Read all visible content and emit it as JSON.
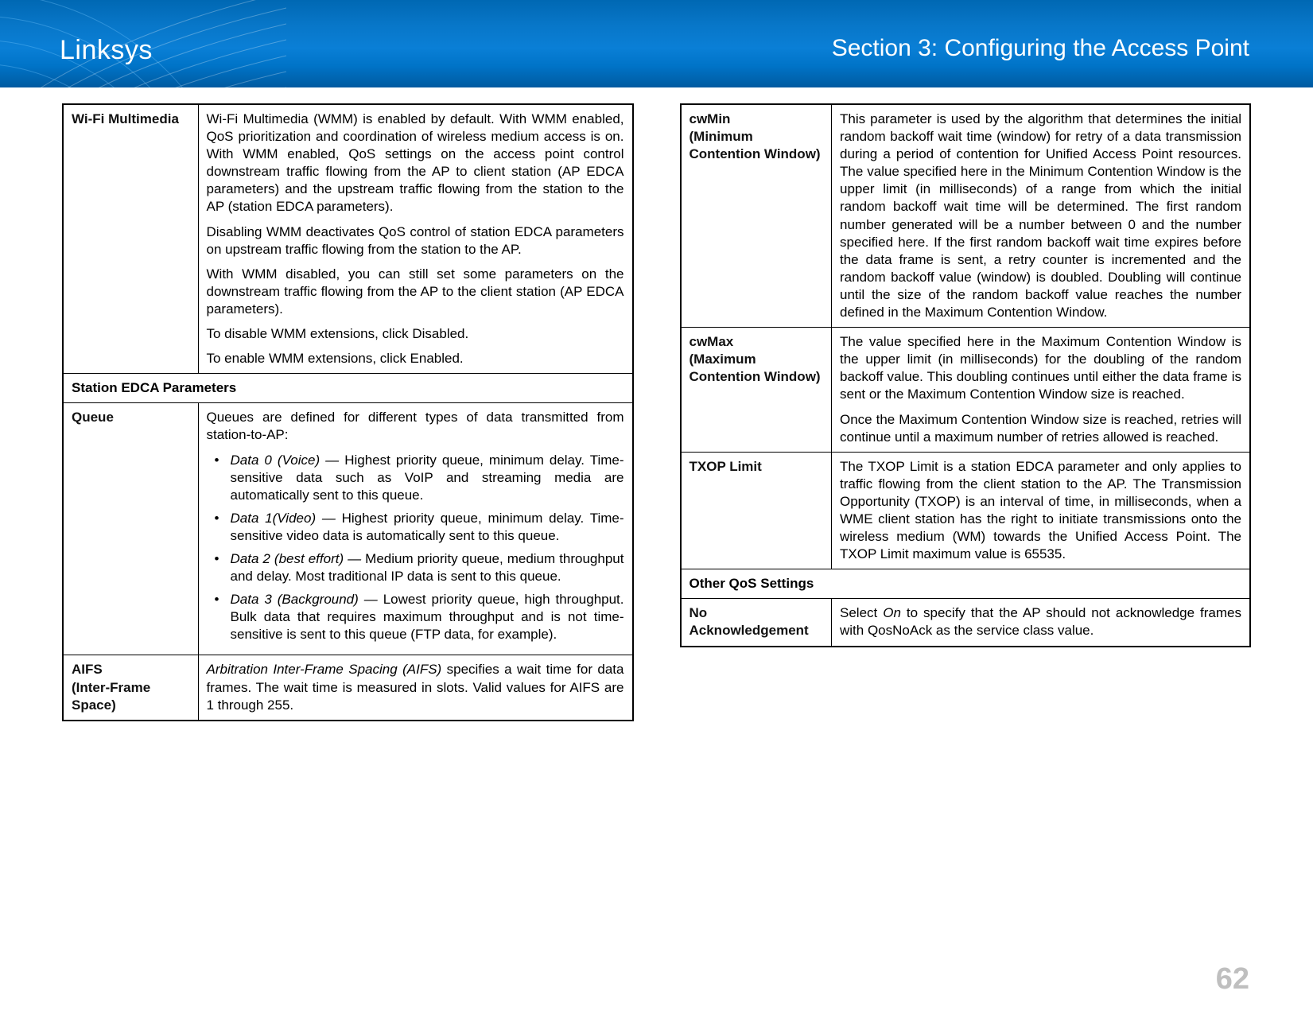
{
  "brand": "Linksys",
  "sectionTitle": "Section 3:  Configuring the Access Point",
  "pageNumber": "62",
  "left": {
    "rows": [
      {
        "label": "Wi-Fi Multimedia",
        "paras": [
          "Wi-Fi Multimedia (WMM) is enabled by default. With WMM enabled, QoS prioritization and coordination of wireless medium access is on. With WMM enabled, QoS settings on the access point control downstream traffic flowing from the AP to client station (AP EDCA parameters) and the upstream traffic flowing from the station to the AP (station EDCA parameters).",
          "Disabling WMM deactivates QoS control of station EDCA parameters on upstream traffic flowing from the station to the AP.",
          "With WMM disabled, you can still set some parameters on the downstream traffic flowing from the AP to the client station (AP EDCA parameters).",
          "To disable WMM extensions, click Disabled.",
          "To enable WMM extensions, click Enabled."
        ]
      }
    ],
    "section1": "Station EDCA Parameters",
    "queue": {
      "label": "Queue",
      "intro": "Queues are defined for different types of data transmitted from station-to-AP:",
      "items": [
        {
          "lead": "Data 0 (Voice) — ",
          "rest": "Highest priority queue, minimum delay. Time-sensitive data such as VoIP and streaming media are automatically sent to this queue."
        },
        {
          "lead": "Data 1(Video) — ",
          "rest": "Highest priority queue, minimum delay. Time-sensitive video data is automatically sent to this queue."
        },
        {
          "lead": "Data 2 (best effort) — ",
          "rest": "Medium priority queue, medium throughput and delay. Most traditional IP data is sent to this queue."
        },
        {
          "lead": "Data 3 (Background) — ",
          "rest": "Lowest priority queue, high throughput. Bulk data that requires maximum throughput and is not time-sensitive is sent to this queue (FTP data, for example)."
        }
      ]
    },
    "aifs": {
      "label1": "AIFS",
      "label2": "(Inter-Frame Space)",
      "lead": "Arbitration Inter-Frame Spacing (AIFS)",
      "rest": " specifies a wait time for data frames. The wait time is measured in slots. Valid values for AIFS are 1 through 255."
    }
  },
  "right": {
    "cwmin": {
      "l1": "cwMin",
      "l2": "(Minimum Contention Window)",
      "p": "This parameter is used by the algorithm that determines the initial random backoff wait time (window) for retry of a data transmission during a period of contention for Unified Access Point resources. The value specified here in the Minimum Contention Window is the upper limit (in milliseconds) of a range from which the initial random backoff wait time will be determined. The first random number generated will be a number between 0 and the number specified here. If the first random backoff wait time expires before the data frame is sent, a retry counter is incremented and the random backoff value (window) is doubled. Doubling will continue until the size of the random backoff value reaches the number defined in the Maximum Contention Window."
    },
    "cwmax": {
      "l1": "cwMax",
      "l2": "(Maximum Contention Window)",
      "p1": "The value specified here in the Maximum Contention Window is the upper limit (in milliseconds) for the doubling of the random backoff value. This doubling continues until either the data frame is sent or the Maximum Contention Window size is reached.",
      "p2": "Once the Maximum Contention Window size is reached, retries will continue until a maximum number of retries allowed is reached."
    },
    "txop": {
      "l1": "TXOP Limit",
      "p": "The TXOP Limit is a station EDCA parameter and only applies to traffic flowing from the client station to the AP. The Transmission Opportunity (TXOP) is an interval of time, in milliseconds, when a WME client station has the right to initiate transmissions onto the wireless medium (WM) towards the Unified Access Point. The TXOP Limit maximum value is 65535."
    },
    "section2": "Other QoS Settings",
    "noack": {
      "l1": "No",
      "l2": "Acknowledgement",
      "lead": "On",
      "before": "Select ",
      "after": " to specify that the AP should not acknowledge frames with QosNoAck as the service class value."
    }
  }
}
